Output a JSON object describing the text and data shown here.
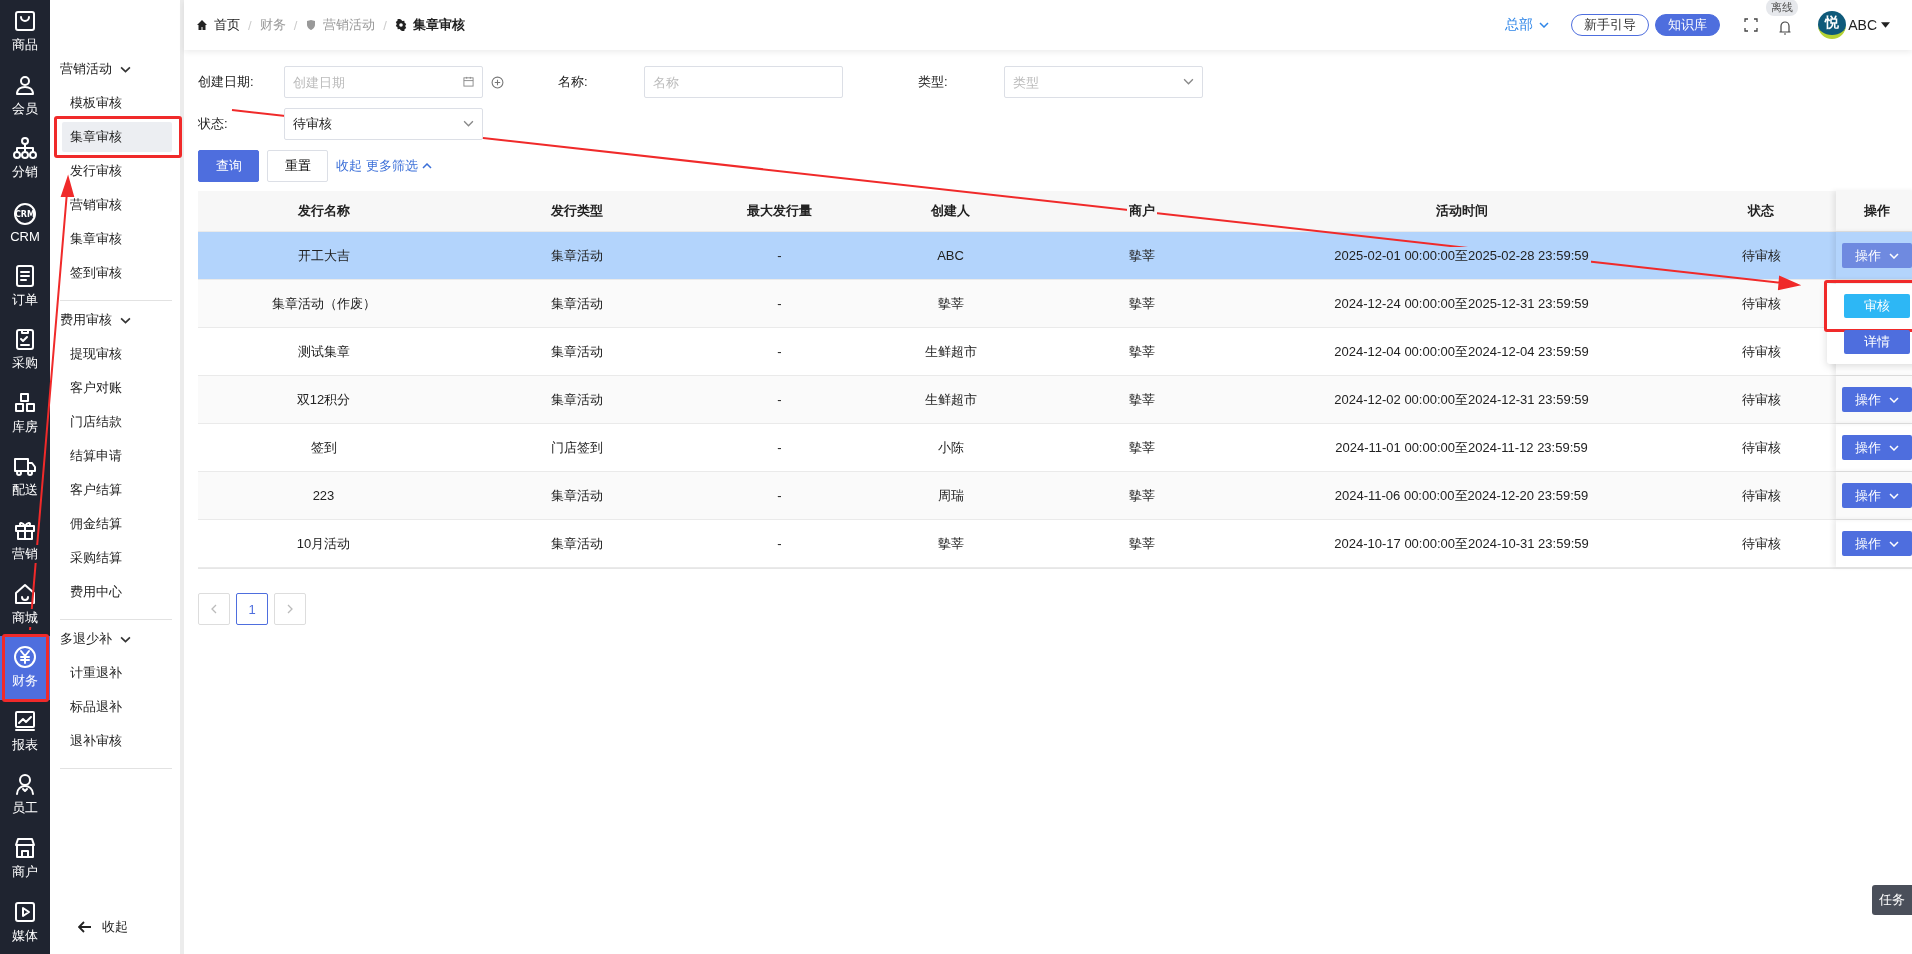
{
  "nav": [
    {
      "label": "商品",
      "selected": false,
      "highlighted": false
    },
    {
      "label": "会员",
      "selected": false,
      "highlighted": false
    },
    {
      "label": "分销",
      "selected": false,
      "highlighted": false
    },
    {
      "label": "CRM",
      "icon_text": "CRM",
      "selected": false,
      "highlighted": false
    },
    {
      "label": "订单",
      "selected": false,
      "highlighted": false
    },
    {
      "label": "采购",
      "selected": false,
      "highlighted": false
    },
    {
      "label": "库房",
      "selected": false,
      "highlighted": false
    },
    {
      "label": "配送",
      "selected": false,
      "highlighted": false
    },
    {
      "label": "营销",
      "selected": false,
      "highlighted": false
    },
    {
      "label": "商城",
      "selected": false,
      "highlighted": false
    },
    {
      "label": "财务",
      "selected": true,
      "highlighted": true
    },
    {
      "label": "报表",
      "selected": false,
      "highlighted": false
    },
    {
      "label": "员工",
      "selected": false,
      "highlighted": false
    },
    {
      "label": "商户",
      "selected": false,
      "highlighted": false
    },
    {
      "label": "媒体",
      "selected": false,
      "highlighted": false
    }
  ],
  "submenu": {
    "groups": [
      {
        "title": "营销活动",
        "expanded": true,
        "items": [
          {
            "label": "模板审核",
            "selected": false,
            "highlighted": false
          },
          {
            "label": "集章审核",
            "selected": true,
            "highlighted": true
          },
          {
            "label": "发行审核",
            "selected": false,
            "highlighted": false
          },
          {
            "label": "营销审核",
            "selected": false,
            "highlighted": false
          },
          {
            "label": "集章审核",
            "selected": false,
            "highlighted": false
          },
          {
            "label": "签到审核",
            "selected": false,
            "highlighted": false
          }
        ]
      },
      {
        "title": "费用审核",
        "expanded": true,
        "items": [
          {
            "label": "提现审核",
            "selected": false,
            "highlighted": false
          },
          {
            "label": "客户对账",
            "selected": false,
            "highlighted": false
          },
          {
            "label": "门店结款",
            "selected": false,
            "highlighted": false
          },
          {
            "label": "结算申请",
            "selected": false,
            "highlighted": false
          },
          {
            "label": "客户结算",
            "selected": false,
            "highlighted": false
          },
          {
            "label": "佣金结算",
            "selected": false,
            "highlighted": false
          },
          {
            "label": "采购结算",
            "selected": false,
            "highlighted": false
          },
          {
            "label": "费用中心",
            "selected": false,
            "highlighted": false
          }
        ]
      },
      {
        "title": "多退少补",
        "expanded": true,
        "items": [
          {
            "label": "计重退补",
            "selected": false,
            "highlighted": false
          },
          {
            "label": "标品退补",
            "selected": false,
            "highlighted": false
          },
          {
            "label": "退补审核",
            "selected": false,
            "highlighted": false
          }
        ]
      }
    ],
    "collapse": "收起"
  },
  "breadcrumb": [
    {
      "label": "首页"
    },
    {
      "separator": "/",
      "label": "财务"
    },
    {
      "separator": "/",
      "label": "营销活动"
    },
    {
      "separator": "/",
      "label": "集章审核"
    }
  ],
  "header": {
    "org": "总部",
    "guide": "新手引导",
    "knowledge": "知识库",
    "offline_badge": "离线",
    "avatar_text": "悦",
    "user": "ABC"
  },
  "filters": {
    "date_label": "创建日期:",
    "date_placeholder": "创建日期",
    "name_label": "名称:",
    "name_placeholder": "名称",
    "type_label": "类型:",
    "type_placeholder": "类型",
    "status_label": "状态:",
    "status_value": "待审核"
  },
  "actions": {
    "query": "查询",
    "reset": "重置",
    "collapse": "收起",
    "more": "更多筛选"
  },
  "table": {
    "columns": [
      "发行名称",
      "发行类型",
      "最大发行量",
      "创建人",
      "商户",
      "活动时间",
      "状态",
      "操作"
    ],
    "rows": [
      {
        "cells": [
          "开工大吉",
          "集章活动",
          "-",
          "ABC",
          "摰莘",
          "2025-02-01 00:00:00至2025-02-28 23:59:59",
          "待审核"
        ],
        "action": "操作",
        "selected": true
      },
      {
        "cells": [
          "集章活动（作废）",
          "集章活动",
          "-",
          "摰莘",
          "摰莘",
          "2024-12-24 00:00:00至2025-12-31 23:59:59",
          "待审核"
        ],
        "selected": false
      },
      {
        "cells": [
          "测试集章",
          "集章活动",
          "-",
          "生鲜超市",
          "摰莘",
          "2024-12-04 00:00:00至2024-12-04 23:59:59",
          "待审核"
        ],
        "selected": false
      },
      {
        "cells": [
          "双12积分",
          "集章活动",
          "-",
          "生鲜超市",
          "摰莘",
          "2024-12-02 00:00:00至2024-12-31 23:59:59",
          "待审核"
        ],
        "action": "操作",
        "selected": false
      },
      {
        "cells": [
          "签到",
          "门店签到",
          "-",
          "小陈",
          "摰莘",
          "2024-11-01 00:00:00至2024-11-12 23:59:59",
          "待审核"
        ],
        "action": "操作",
        "selected": false
      },
      {
        "cells": [
          "223",
          "集章活动",
          "-",
          "周瑞",
          "摰莘",
          "2024-11-06 00:00:00至2024-12-20 23:59:59",
          "待审核"
        ],
        "action": "操作",
        "selected": false
      },
      {
        "cells": [
          "10月活动",
          "集章活动",
          "-",
          "摰莘",
          "摰莘",
          "2024-10-17 00:00:00至2024-10-31 23:59:59",
          "待审核"
        ],
        "action": "操作",
        "selected": false
      }
    ]
  },
  "dropdown": {
    "items": [
      {
        "label": "审核",
        "highlighted": true
      },
      {
        "label": "详情",
        "highlighted": false
      }
    ]
  },
  "pagination": {
    "pages": [
      {
        "label": "1",
        "selected": true
      }
    ]
  },
  "task_button": "任务"
}
